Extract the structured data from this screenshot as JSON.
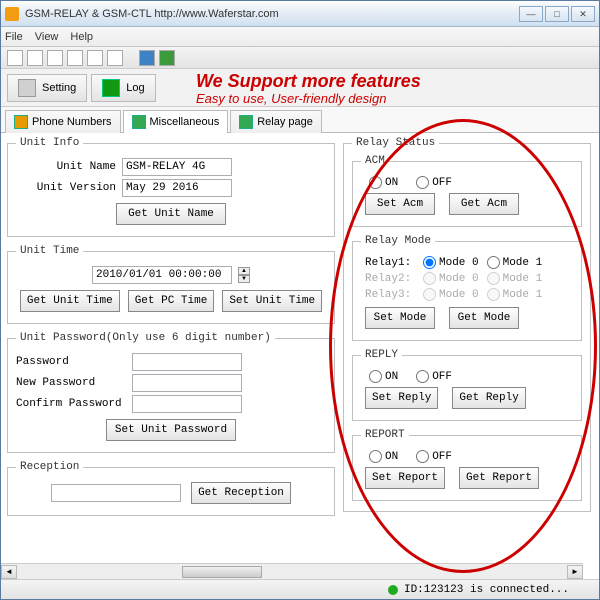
{
  "titlebar": {
    "title": "GSM-RELAY & GSM-CTL    http://www.Waferstar.com"
  },
  "menubar": {
    "file": "File",
    "view": "View",
    "help": "Help"
  },
  "bigtabs": {
    "setting": "Setting",
    "log": "Log"
  },
  "marketing": {
    "line1": "We Support more features",
    "line2": "Easy to use, User-friendly design"
  },
  "tabs": {
    "phone": "Phone Numbers",
    "misc": "Miscellaneous",
    "relay": "Relay page"
  },
  "unit_info": {
    "legend": "Unit Info",
    "name_label": "Unit Name",
    "name_value": "GSM-RELAY 4G",
    "version_label": "Unit Version",
    "version_value": "May 29 2016",
    "btn": "Get Unit Name"
  },
  "unit_time": {
    "legend": "Unit Time",
    "value": "2010/01/01 00:00:00",
    "get_unit": "Get Unit Time",
    "get_pc": "Get PC Time",
    "set": "Set Unit Time"
  },
  "unit_pw": {
    "legend": "Unit Password(Only use 6 digit number)",
    "pw": "Password",
    "new": "New Password",
    "confirm": "Confirm Password",
    "btn": "Set Unit Password"
  },
  "reception": {
    "legend": "Reception",
    "btn": "Get Reception"
  },
  "relay_status": {
    "legend": "Relay Status"
  },
  "acm": {
    "legend": "ACM",
    "on": "ON",
    "off": "OFF",
    "set": "Set Acm",
    "get": "Get Acm"
  },
  "relay_mode": {
    "legend": "Relay Mode",
    "relay1": "Relay1:",
    "relay2": "Relay2:",
    "relay3": "Relay3:",
    "mode0": "Mode 0",
    "mode1": "Mode 1",
    "set": "Set Mode",
    "get": "Get Mode"
  },
  "reply": {
    "legend": "REPLY",
    "on": "ON",
    "off": "OFF",
    "set": "Set Reply",
    "get": "Get Reply"
  },
  "report": {
    "legend": "REPORT",
    "on": "ON",
    "off": "OFF",
    "set": "Set Report",
    "get": "Get Report"
  },
  "statusbar": {
    "text": "ID:123123 is connected..."
  }
}
